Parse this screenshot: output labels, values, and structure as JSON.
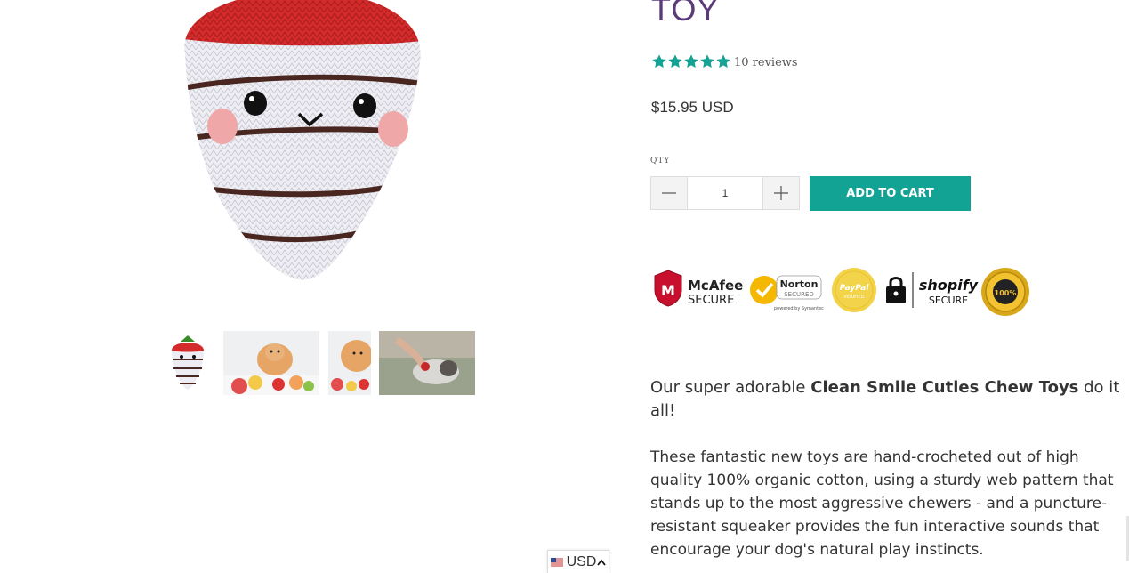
{
  "product": {
    "title_fragment": "TOY",
    "rating": {
      "stars": 5,
      "reviews_text": "10 reviews"
    },
    "price": "$15.95 USD",
    "qty_label": "QTY",
    "qty_value": "1",
    "add_to_cart_label": "ADD TO CART"
  },
  "badges": {
    "mcafee": {
      "line1": "McAfee",
      "line2": "SECURE"
    },
    "norton": {
      "line1": "Norton",
      "line2": "SECURED",
      "line3": "powered by Symantec"
    },
    "paypal": {
      "line1": "PayPal",
      "line2": "VERIFIED"
    },
    "shopify": {
      "line1": "shopify",
      "line2": "SECURE"
    },
    "guarantee": {
      "line1": "100%",
      "ring": "SATISFACTION GUARANTEE"
    }
  },
  "description": {
    "intro_before": "Our super adorable ",
    "intro_bold": "Clean Smile Cuties Chew Toys",
    "intro_after": " do it all!",
    "body": "These fantastic new toys are hand-crocheted out of high quality 100% organic cotton, using a sturdy web pattern that stands up to the most aggressive chewers - and a puncture-resistant squeaker provides the fun interactive sounds that encourage your dog's natural play instincts."
  },
  "currency": {
    "code": "USD"
  },
  "colors": {
    "accent": "#12a394",
    "star": "#12a394",
    "title": "#5b3a7a"
  }
}
